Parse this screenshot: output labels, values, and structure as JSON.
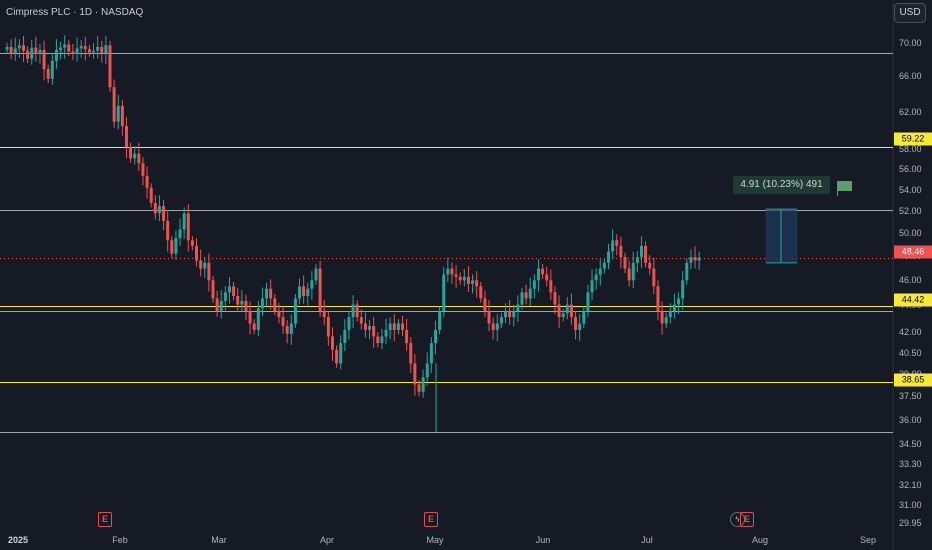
{
  "header": {
    "title": "Cimpress PLC · 1D · NASDAQ",
    "currency_button": "USD"
  },
  "measure_label": "4.91 (10.23%) 491",
  "x_axis": [
    "2025",
    "Feb",
    "Mar",
    "Apr",
    "May",
    "Jun",
    "Jul",
    "Aug",
    "Sep"
  ],
  "y_axis": [
    "70.00",
    "66.00",
    "62.00",
    "58.00",
    "56.00",
    "54.00",
    "52.00",
    "50.00",
    "48.00",
    "46.00",
    "44.00",
    "42.00",
    "40.50",
    "39.00",
    "37.50",
    "36.00",
    "34.50",
    "33.30",
    "32.10",
    "31.00",
    "29.95"
  ],
  "price_badges": {
    "current": "48.46",
    "levels": [
      "59.22",
      "44.42",
      "38.65"
    ]
  },
  "earnings_markers": [
    "E",
    "E",
    "E"
  ],
  "dividend_marker": "ϟ",
  "colors": {
    "background": "#161a25",
    "up": "#26a69a",
    "down": "#ef5350",
    "level_yellow": "#f7e93a",
    "level_white": "#d1d4dc"
  },
  "chart_data": {
    "type": "candlestick",
    "title": "Cimpress PLC · 1D · NASDAQ",
    "y_unit": "USD",
    "scale": "log",
    "ylim": [
      29.95,
      71.5
    ],
    "x_ticks": [
      "2025",
      "Feb",
      "Mar",
      "Apr",
      "May",
      "Jun",
      "Jul",
      "Aug",
      "Sep"
    ],
    "current_price": 48.46,
    "horizontal_levels": [
      {
        "price": 70.2,
        "color": "white"
      },
      {
        "price": 59.22,
        "color": "yellow"
      },
      {
        "price": 52.8,
        "color": "white"
      },
      {
        "price": 44.42,
        "color": "yellow"
      },
      {
        "price": 44.0,
        "color": "white"
      },
      {
        "price": 38.65,
        "color": "yellow"
      },
      {
        "price": 35.3,
        "color": "white"
      }
    ],
    "measurement": {
      "from": 48.0,
      "to": 52.91,
      "change": 4.91,
      "percent": 10.23,
      "bars": 491
    },
    "closes": [
      71.0,
      70.2,
      70.8,
      71.2,
      70.5,
      69.5,
      70.9,
      70.1,
      70.6,
      68.2,
      67.0,
      69.2,
      70.6,
      70.9,
      71.3,
      70.4,
      70.1,
      70.8,
      71.1,
      70.7,
      70.3,
      70.5,
      71.0,
      70.2,
      71.2,
      66.0,
      62.0,
      63.8,
      61.5,
      59.2,
      58.0,
      58.5,
      57.5,
      56.2,
      55.0,
      53.5,
      52.5,
      53.2,
      51.8,
      50.0,
      48.8,
      50.2,
      51.0,
      52.5,
      50.0,
      49.5,
      48.2,
      47.5,
      48.0,
      46.5,
      45.0,
      44.0,
      44.8,
      45.5,
      46.0,
      45.2,
      44.5,
      44.8,
      44.0,
      43.0,
      42.5,
      44.2,
      45.0,
      45.8,
      45.0,
      44.0,
      43.5,
      42.8,
      42.2,
      43.0,
      45.0,
      46.0,
      45.2,
      45.8,
      46.5,
      47.5,
      44.0,
      43.5,
      42.0,
      41.0,
      40.0,
      41.5,
      42.5,
      43.5,
      44.5,
      43.5,
      43.0,
      42.5,
      42.8,
      42.0,
      41.5,
      42.0,
      42.5,
      43.0,
      42.5,
      43.0,
      42.5,
      41.5,
      40.0,
      38.5,
      38.0,
      39.0,
      40.0,
      41.5,
      42.5,
      44.0,
      47.0,
      47.5,
      47.0,
      46.8,
      46.5,
      46.8,
      46.2,
      46.5,
      46.0,
      45.0,
      44.0,
      43.0,
      42.5,
      43.0,
      43.5,
      44.0,
      43.5,
      44.0,
      44.5,
      45.5,
      45.0,
      45.8,
      46.5,
      47.5,
      47.0,
      46.5,
      45.5,
      44.5,
      43.5,
      43.8,
      44.5,
      43.5,
      42.5,
      43.0,
      44.0,
      45.5,
      46.5,
      47.0,
      47.5,
      48.0,
      49.0,
      50.0,
      49.5,
      48.5,
      47.5,
      46.5,
      48.0,
      48.5,
      49.5,
      48.0,
      47.5,
      46.0,
      44.0,
      43.0,
      43.5,
      44.0,
      44.5,
      45.0,
      46.5,
      48.0,
      48.5,
      48.2,
      48.46
    ]
  }
}
